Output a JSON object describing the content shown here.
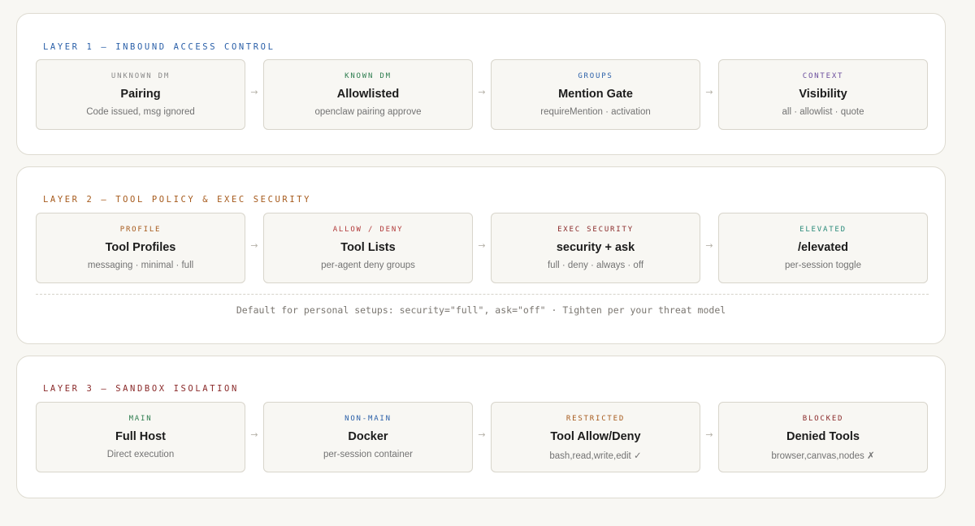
{
  "colors": {
    "page_bg": "#f8f7f3",
    "panel_bg": "#ffffff",
    "card_bg": "#f8f7f3",
    "blue": "#2a5fa8",
    "gray": "#8a8a8a",
    "green": "#2e7d4f",
    "purple": "#6a4c9c",
    "orange": "#a65a1c",
    "red": "#b23b3b",
    "teal": "#2a8a7a",
    "dark_red": "#8a2a2a"
  },
  "arrow_glyph": "→",
  "layers": [
    {
      "title": "LAYER 1 — INBOUND ACCESS CONTROL",
      "title_color": "#2a5fa8",
      "cards": [
        {
          "tag": "UNKNOWN DM",
          "tag_color": "#8a8a8a",
          "name": "Pairing",
          "desc": "Code issued, msg ignored"
        },
        {
          "tag": "KNOWN DM",
          "tag_color": "#2e7d4f",
          "name": "Allowlisted",
          "desc": "openclaw pairing approve"
        },
        {
          "tag": "GROUPS",
          "tag_color": "#2a5fa8",
          "name": "Mention Gate",
          "desc": "requireMention · activation"
        },
        {
          "tag": "CONTEXT",
          "tag_color": "#6a4c9c",
          "name": "Visibility",
          "desc": "all · allowlist · quote"
        }
      ]
    },
    {
      "title": "LAYER 2 — TOOL POLICY & EXEC SECURITY",
      "title_color": "#a65a1c",
      "cards": [
        {
          "tag": "PROFILE",
          "tag_color": "#a65a1c",
          "name": "Tool Profiles",
          "desc": "messaging · minimal · full"
        },
        {
          "tag": "ALLOW / DENY",
          "tag_color": "#b23b3b",
          "name": "Tool Lists",
          "desc": "per-agent deny groups"
        },
        {
          "tag": "EXEC SECURITY",
          "tag_color": "#8a2a2a",
          "name": "security + ask",
          "desc": "full · deny · always · off"
        },
        {
          "tag": "ELEVATED",
          "tag_color": "#2a8a7a",
          "name": "/elevated",
          "desc": "per-session toggle"
        }
      ],
      "note": "Default for personal setups: security=\"full\", ask=\"off\" · Tighten per your threat model"
    },
    {
      "title": "LAYER 3 — SANDBOX ISOLATION",
      "title_color": "#8a2a2a",
      "cards": [
        {
          "tag": "MAIN",
          "tag_color": "#2e7d4f",
          "name": "Full Host",
          "desc": "Direct execution"
        },
        {
          "tag": "NON-MAIN",
          "tag_color": "#2a5fa8",
          "name": "Docker",
          "desc": "per-session container"
        },
        {
          "tag": "RESTRICTED",
          "tag_color": "#a65a1c",
          "name": "Tool Allow/Deny",
          "desc": "bash,read,write,edit ✓"
        },
        {
          "tag": "BLOCKED",
          "tag_color": "#8a2a2a",
          "name": "Denied Tools",
          "desc": "browser,canvas,nodes ✗"
        }
      ]
    }
  ]
}
